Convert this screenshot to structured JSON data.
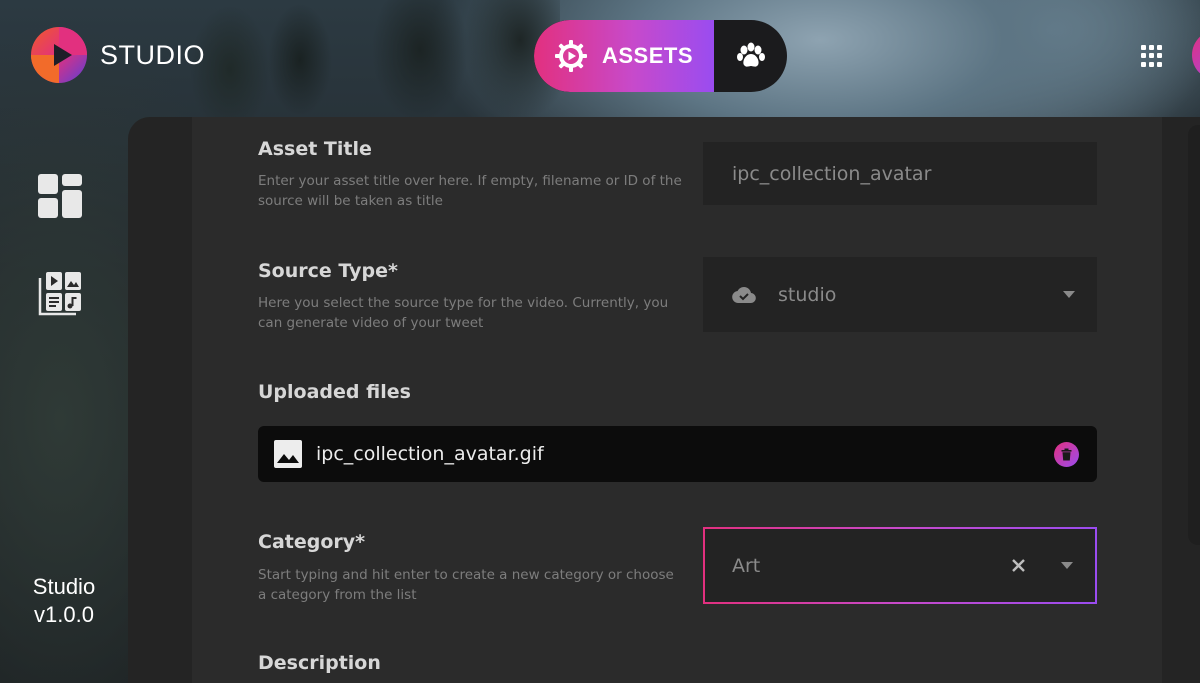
{
  "app": {
    "name": "STUDIO",
    "version_line1": "Studio",
    "version_line2": "v1.0.0"
  },
  "header": {
    "active_tab": {
      "label": "ASSETS",
      "icon": "gear-play-icon"
    },
    "secondary_tab": {
      "icon": "paw-icon"
    },
    "apps_icon": "grid-icon"
  },
  "sidebar": {
    "items": [
      {
        "icon": "dashboard-icon"
      },
      {
        "icon": "media-library-icon"
      }
    ]
  },
  "form": {
    "asset_title": {
      "label": "Asset Title",
      "help": "Enter your asset title over here. If empty, filename or ID of the source will be taken as title",
      "value": "ipc_collection_avatar"
    },
    "source_type": {
      "label": "Source Type*",
      "help": "Here you select the source type for the video. Currently, you can generate video of your tweet",
      "value": "studio",
      "icon": "cloud-icon"
    },
    "uploaded_files": {
      "label": "Uploaded files",
      "files": [
        {
          "name": "ipc_collection_avatar.gif",
          "icon": "image-icon"
        }
      ]
    },
    "category": {
      "label": "Category*",
      "help": "Start typing and hit enter to create a new category or choose a category from the list",
      "value": "Art"
    },
    "description": {
      "label": "Description"
    }
  },
  "colors": {
    "accent_start": "#e2307f",
    "accent_mid": "#c74acb",
    "accent_end": "#9a4cf0",
    "panel": "#2b2b2b",
    "field": "#232323"
  }
}
